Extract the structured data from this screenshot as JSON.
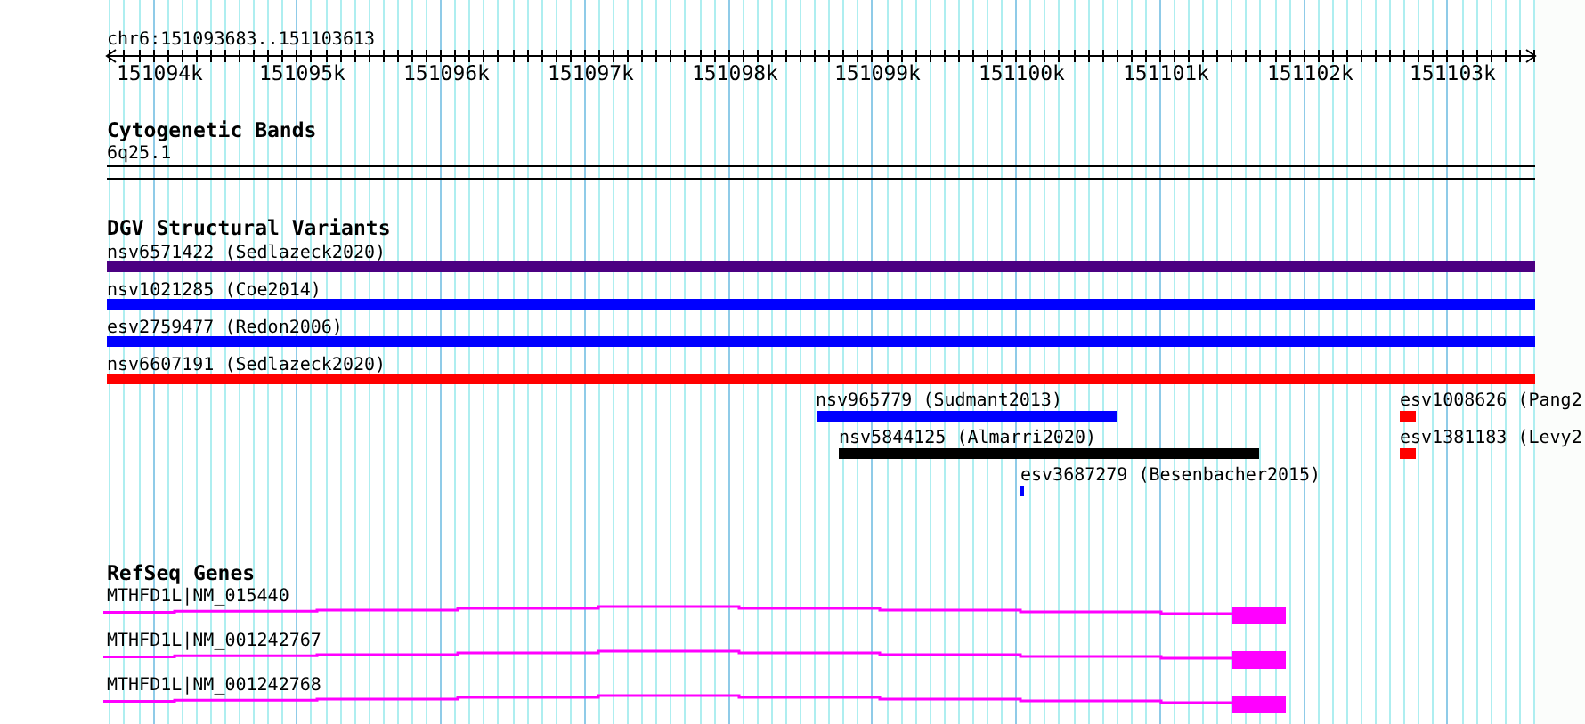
{
  "ruler": {
    "location": "chr6:151093683..151103613",
    "ticks": [
      "151094k",
      "151095k",
      "151096k",
      "151097k",
      "151098k",
      "151099k",
      "151100k",
      "151101k",
      "151102k",
      "151103k"
    ]
  },
  "tracks": [
    {
      "kind": "bands",
      "title": "Cytogenetic Bands",
      "features": [
        {
          "label": "6q25.1"
        }
      ]
    },
    {
      "kind": "variants",
      "title": "DGV Structural Variants",
      "features": [
        {
          "label": "nsv6571422 (Sedlazeck2020)",
          "color": "#4b0082"
        },
        {
          "label": "nsv1021285 (Coe2014)",
          "color": "#0000ff"
        },
        {
          "label": "esv2759477 (Redon2006)",
          "color": "#0000ff"
        },
        {
          "label": "nsv6607191 (Sedlazeck2020)",
          "color": "#ff0000"
        },
        {
          "label": "nsv965779 (Sudmant2013)",
          "color": "#0000ff"
        },
        {
          "label": "esv1008626 (Pang2",
          "color": "#ff0000"
        },
        {
          "label": "nsv5844125 (Almarri2020)",
          "color": "#000000"
        },
        {
          "label": "esv1381183 (Levy2",
          "color": "#ff0000"
        },
        {
          "label": "esv3687279 (Besenbacher2015)",
          "color": "#0000ff"
        }
      ]
    },
    {
      "kind": "genes",
      "title": "RefSeq Genes",
      "features": [
        {
          "label": "MTHFD1L|NM_015440"
        },
        {
          "label": "MTHFD1L|NM_001242767"
        },
        {
          "label": "MTHFD1L|NM_001242768"
        }
      ]
    }
  ]
}
